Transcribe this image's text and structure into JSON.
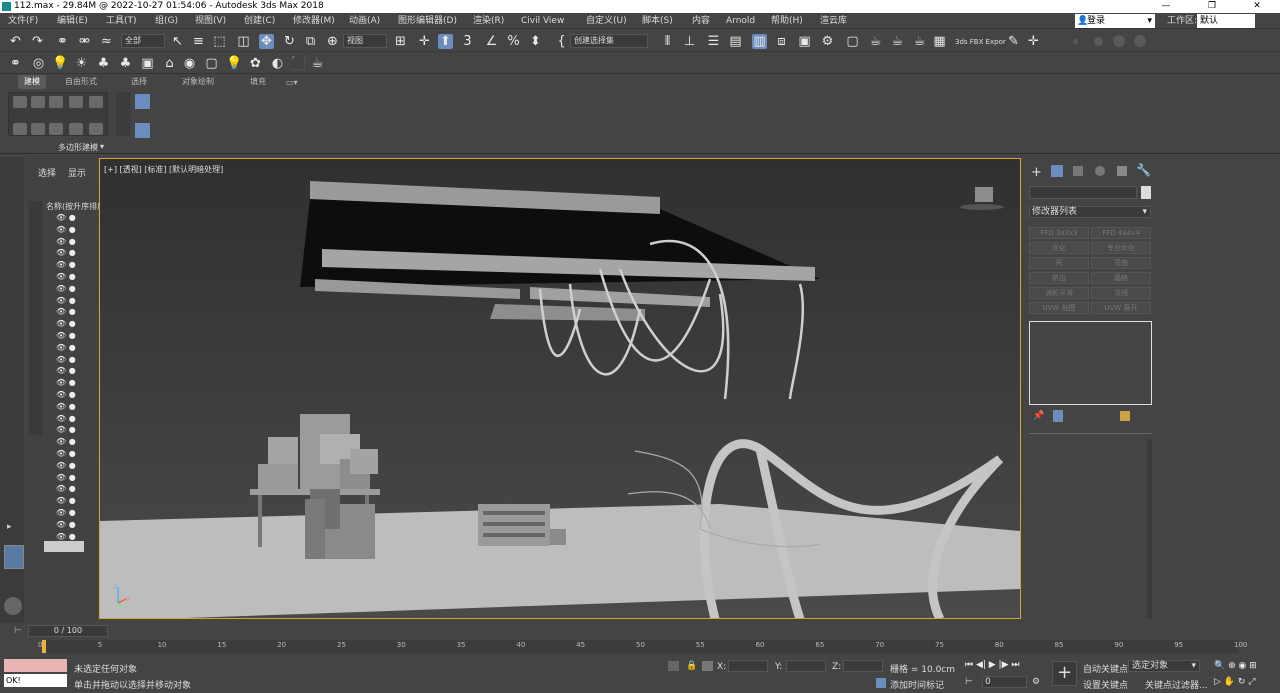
{
  "titlebar": {
    "title": "112.max - 29.84M @ 2022-10-27 01:54:06 - Autodesk 3ds Max 2018",
    "min": "—",
    "max": "❐",
    "close": "✕"
  },
  "menu": [
    "文件(F)",
    "编辑(E)",
    "工具(T)",
    "组(G)",
    "视图(V)",
    "创建(C)",
    "修改器(M)",
    "动画(A)",
    "图形编辑器(D)",
    "渲染(R)",
    "Civil View",
    "自定义(U)",
    "脚本(S)",
    "内容",
    "Arnold",
    "帮助(H)",
    "渲云库"
  ],
  "login": "登录",
  "workspace": {
    "label": "工作区:",
    "value": "默认"
  },
  "toolbar": {
    "filter": "全部",
    "view_dd": "视图",
    "selset": "创建选择集",
    "fbx": "3ds FBX Expor"
  },
  "ribbon": {
    "tabs": [
      "建模",
      "自由形式",
      "选择",
      "对象绘制",
      "填充"
    ],
    "panel_label": "多边形建模"
  },
  "scene_explorer": {
    "tabs": [
      "选择",
      "显示"
    ],
    "header": "名称(按升序排序)"
  },
  "viewport": {
    "label": "[+] [透视] [标准] [默认明暗处理]",
    "axis_x": "x",
    "axis_z": "z"
  },
  "cmd_panel": {
    "modifier_list": "修改器列表",
    "buttons": [
      "FFD 3x3x3",
      "FFD 4x4x4",
      "优化",
      "专业优化",
      "壳",
      "弯曲",
      "挤出",
      "晶格",
      "涡轮平滑",
      "法线",
      "UVW 贴图",
      "UVW 展开"
    ]
  },
  "timeline": {
    "frame": "0 / 100",
    "ticks": [
      "0",
      "5",
      "10",
      "15",
      "20",
      "25",
      "30",
      "35",
      "40",
      "45",
      "50",
      "55",
      "60",
      "65",
      "70",
      "75",
      "80",
      "85",
      "90",
      "95",
      "100"
    ]
  },
  "status": {
    "line1": "未选定任何对象",
    "line2": "单击并拖动以选择并移动对象",
    "x_label": "X:",
    "y_label": "Y:",
    "z_label": "Z:",
    "grid": "栅格 = 10.0cm",
    "add_tag": "添加时间标记",
    "auto_key": "自动关键点",
    "set_key": "设置关键点",
    "selected": "选定对象",
    "key_filter": "关键点过滤器...",
    "frame_field": "0",
    "script": "OK!"
  }
}
